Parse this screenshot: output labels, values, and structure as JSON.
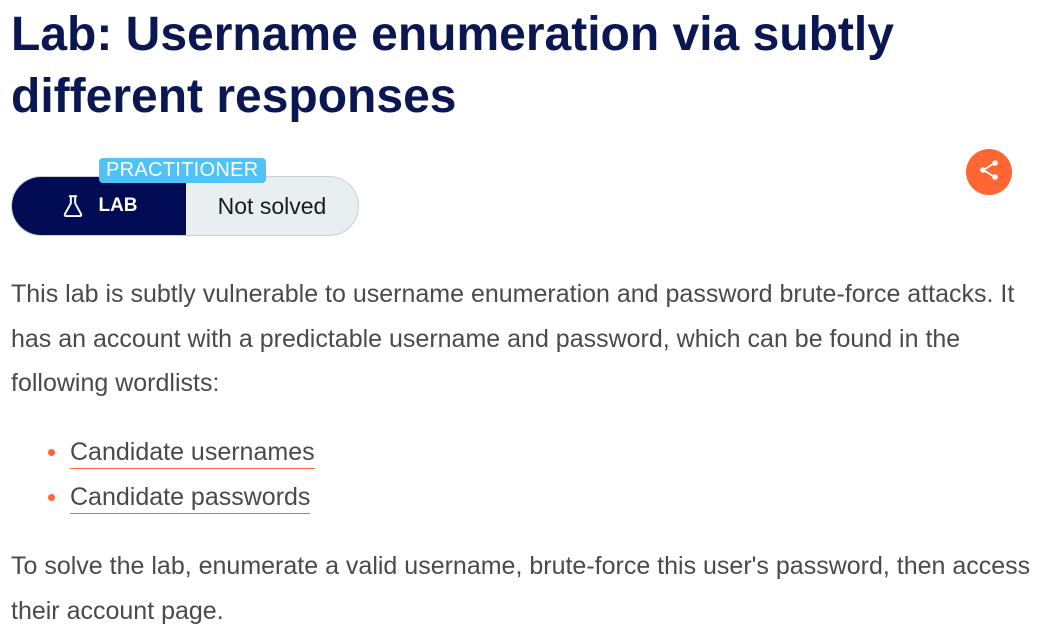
{
  "title": "Lab: Username enumeration via subtly different responses",
  "lab_widget": {
    "level": "PRACTITIONER",
    "lab_label": "LAB",
    "status": "Not solved",
    "icon": "flask-icon"
  },
  "share": {
    "icon": "share-icon",
    "color": "#ff6633"
  },
  "description": "This lab is subtly vulnerable to username enumeration and password brute-force attacks. It has an account with a predictable username and password, which can be found in the following wordlists:",
  "wordlists": [
    "Candidate usernames",
    "Candidate passwords"
  ],
  "instructions": "To solve the lab, enumerate a valid username, brute-force this user's password, then access their account page.",
  "colors": {
    "title": "#0a1752",
    "lab_dark": "#010c55",
    "badge": "#4fc3f7",
    "accent": "#ff6633",
    "body_text": "#4a4a4a"
  }
}
